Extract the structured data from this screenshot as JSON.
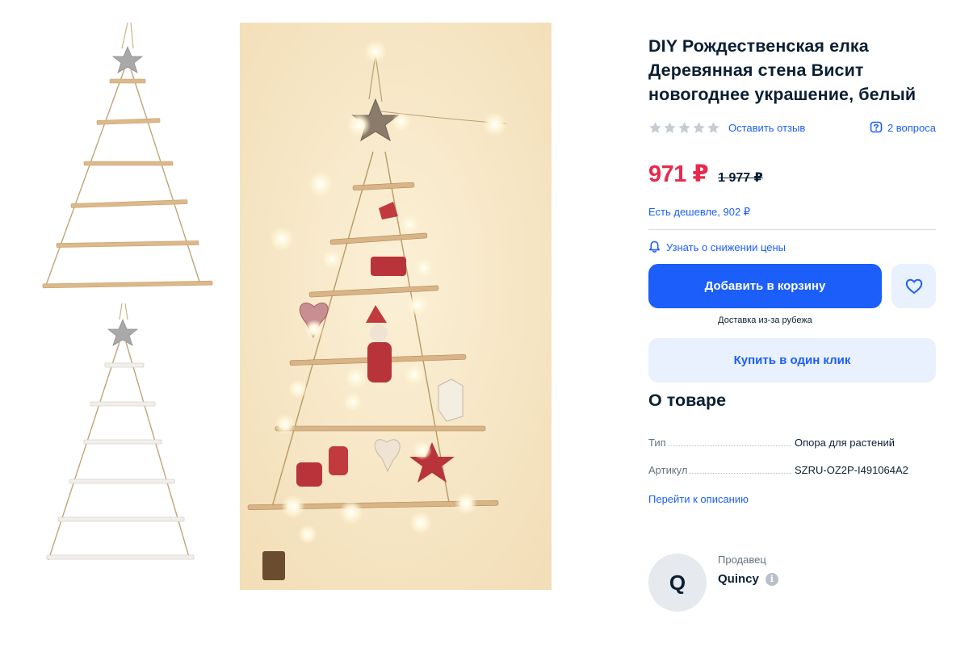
{
  "product": {
    "title": "DIY Рождественская елка Деревянная стена Висит новогоднее украшение, белый"
  },
  "rating": {
    "stars_filled": 0,
    "stars_total": 5,
    "review_link": "Оставить отзыв",
    "questions_label": "2 вопроса"
  },
  "price": {
    "current": "971 ₽",
    "old": "1 977 ₽",
    "cheaper_link": "Есть дешевле, 902 ₽",
    "notify_label": "Узнать о снижении цены"
  },
  "actions": {
    "add_to_cart": "Добавить в корзину",
    "delivery_note": "Доставка из-за рубежа",
    "one_click": "Купить в один клик"
  },
  "about": {
    "title": "О товаре",
    "specs": [
      {
        "name": "Тип",
        "value": "Опора для растений"
      },
      {
        "name": "Артикул",
        "value": "SZRU-OZ2P-I491064A2"
      }
    ],
    "to_description": "Перейти к описанию"
  },
  "seller": {
    "avatar_letter": "Q",
    "label": "Продавец",
    "name": "Quincy"
  },
  "gallery": {
    "thumbnails": [
      {
        "icon": "wooden-tree-natural-thumbnail"
      },
      {
        "icon": "wooden-tree-white-thumbnail"
      }
    ],
    "main_image": "lit-wall-tree-photo"
  },
  "colors": {
    "accent_blue": "#1c5ef9",
    "price_red": "#e8294c",
    "light_blue_bg": "#eaf1fe",
    "text_dark": "#0b1f33",
    "text_gray": "#66727f"
  }
}
